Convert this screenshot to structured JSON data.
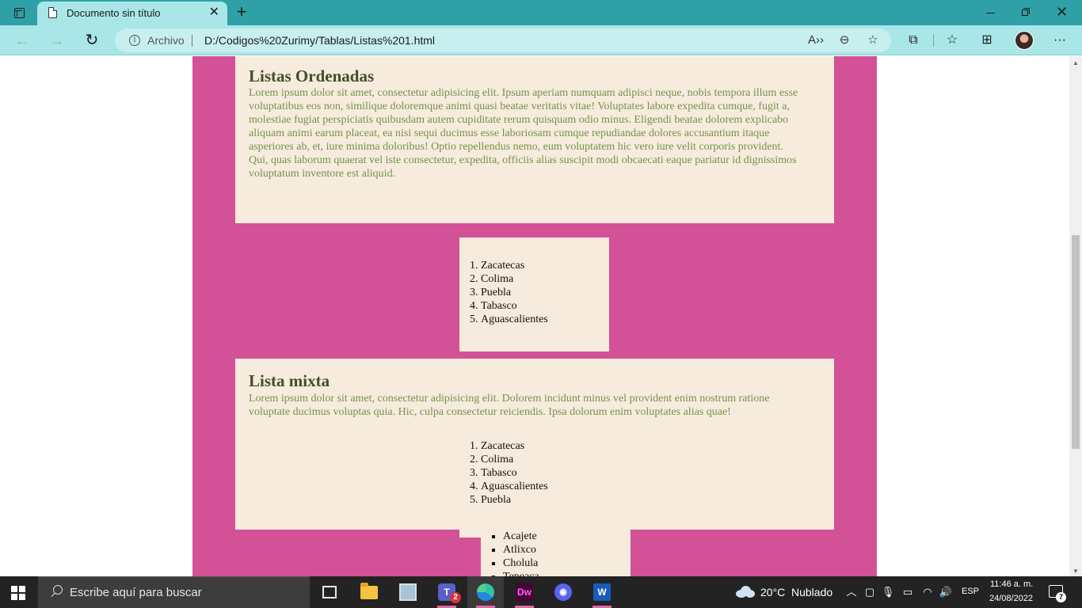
{
  "browser": {
    "tab_title": "Documento sin título",
    "address_site_label": "Archivo",
    "url": "D:/Codigos%20Zurimy/Tablas/Listas%201.html"
  },
  "page": {
    "section1": {
      "heading": "Listas Ordenadas",
      "paragraph_lines": [
        "Lorem ipsum dolor sit amet, consectetur adipisicing elit. Ipsum aperiam numquam adipisci neque, nobis tempora illum esse",
        "voluptatibus eos non, similique doloremque animi quasi beatae veritatis vitae! Voluptates labore expedita cumque, fugit a,",
        "molestiae fugiat perspiciatis quibusdam autem cupiditate rerum quisquam odio minus. Eligendi beatae dolorem explicabo",
        "aliquam animi earum placeat, ea nisi sequi ducimus esse laboriosam cumque repudiandae dolores accusantium itaque",
        "asperiores ab, et, iure minima doloribus! Optio repellendus nemo, eum voluptatem hic vero iure velit corporis provident.",
        "Qui, quas laborum quaerat vel iste consectetur, expedita, officiis alias suscipit modi obcaecati eaque pariatur id dignissimos",
        "voluptatum inventore est aliquid."
      ]
    },
    "ordered_list_1": [
      "Zacatecas",
      "Colima",
      "Puebla",
      "Tabasco",
      "Aguascalientes"
    ],
    "section2": {
      "heading": "Lista mixta",
      "paragraph_lines": [
        "Lorem ipsum dolor sit amet, consectetur adipisicing elit. Dolorem incidunt minus vel provident enim nostrum ratione",
        "voluptate ducimus voluptas quia. Hic, culpa consectetur reiciendis. Ipsa dolorum enim voluptates alias quae!"
      ]
    },
    "ordered_list_2": [
      "Zacatecas",
      "Colima",
      "Tabasco",
      "Aguascalientes",
      "Puebla"
    ],
    "unordered_list": [
      "Acajete",
      "Atlixco",
      "Cholula",
      "Tepeaca"
    ]
  },
  "taskbar": {
    "search_placeholder": "Escribe aquí para buscar",
    "teams_badge": "2",
    "weather_temp": "20°C",
    "weather_desc": "Nublado",
    "language": "ESP",
    "time": "11:46 a. m.",
    "date": "24/08/2022",
    "notification_count": "7"
  },
  "colors": {
    "tabbar_bg": "#2fa1a6",
    "toolbar_bg": "#a9e6e7",
    "page_column": "#d35196",
    "card_bg": "#f7ebdd",
    "heading_text": "#3f4f2a",
    "paragraph_text": "#73944b"
  },
  "icons": {
    "tab": "document-icon",
    "back": "arrow-left-icon",
    "forward": "arrow-right-icon",
    "reload": "reload-icon",
    "info": "info-icon",
    "read_aloud": "read-aloud-icon",
    "zoom": "zoom-out-icon",
    "favorite_add": "star-plus-icon",
    "extensions": "puzzle-icon",
    "favorites": "favorites-icon",
    "collections": "collections-icon",
    "menu": "more-icon"
  }
}
